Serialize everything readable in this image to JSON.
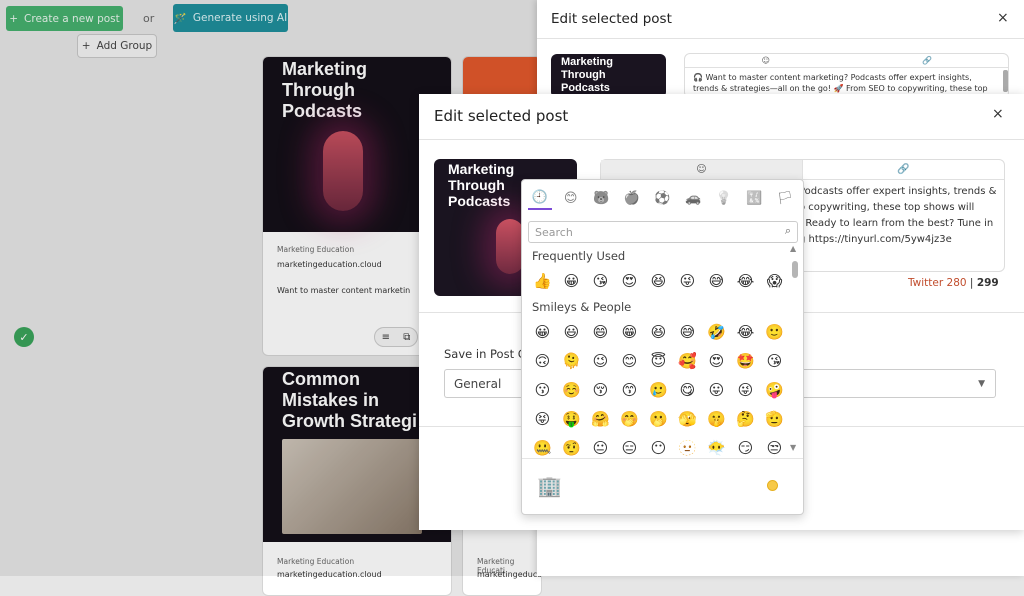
{
  "toolbar": {
    "create_label": "Create a new post",
    "or_label": "or",
    "ai_label": "Generate using AI",
    "add_group_label": "Add Group"
  },
  "cards": [
    {
      "title": "Marketing\nThrough\nPodcasts",
      "author": "Marketing Education",
      "site": "marketingeducation.cloud",
      "excerpt": "Want to master content marketin"
    },
    {
      "title": "Common\nMistakes in\nGrowth Strategi",
      "author": "Marketing Education",
      "site": "marketingeducation.cloud"
    }
  ],
  "card_partial": {
    "author": "Marketing Educati",
    "site": "marketingeduca"
  },
  "back_panel": {
    "title": "Edit selected post",
    "close": "×",
    "thumb_title": "Marketing\nThrough\nPodcasts",
    "text": "🎧 Want to master content marketing? Podcasts offer expert insights, trends & strategies—all on the go! 🚀 From SEO to copywriting, these top shows will"
  },
  "modal": {
    "title": "Edit selected post",
    "close": "×",
    "thumb_title": "Marketing\nThrough\nPodcasts",
    "editor_text": "Podcasts offer expert insights, trends &\no copywriting, these top shows will\n. Ready to learn from the best? Tune in\ng https://tinyurl.com/5yw4jz3e",
    "counter_twitter": "Twitter 280",
    "counter_sep": "|",
    "counter_total": "299",
    "save_label": "Save in Post G",
    "group_value": "General"
  },
  "emoji_picker": {
    "categories": [
      "🕘",
      "😊",
      "🐻",
      "🍎",
      "⚽",
      "🚗",
      "💡",
      "🔣",
      "🏳"
    ],
    "search_placeholder": "Search",
    "frequently_used_label": "Frequently Used",
    "frequently_used": [
      "👍",
      "😀",
      "😘",
      "😍",
      "😆",
      "😜",
      "😅",
      "😂",
      "😱"
    ],
    "smileys_label": "Smileys & People",
    "smileys": [
      "😀",
      "😃",
      "😄",
      "😁",
      "😆",
      "😅",
      "🤣",
      "😂",
      "🙂",
      "🙃",
      "🫠",
      "😉",
      "😊",
      "😇",
      "🥰",
      "😍",
      "🤩",
      "😘",
      "😗",
      "☺️",
      "😚",
      "😙",
      "🥲",
      "😋",
      "😛",
      "😜",
      "🤪",
      "😝",
      "🤑",
      "🤗",
      "🤭",
      "🫢",
      "🫣",
      "🤫",
      "🤔",
      "🫡",
      "🤐",
      "🤨",
      "😐",
      "😑",
      "😶",
      "🫥",
      "😶‍🌫️",
      "😏",
      "😒"
    ],
    "preview_emoji": "🏢"
  },
  "colors": {
    "green": "#46b06e",
    "teal": "#1f8f9c",
    "twitter_counter": "#c14d2d",
    "picker_accent": "#7b4bd6"
  }
}
